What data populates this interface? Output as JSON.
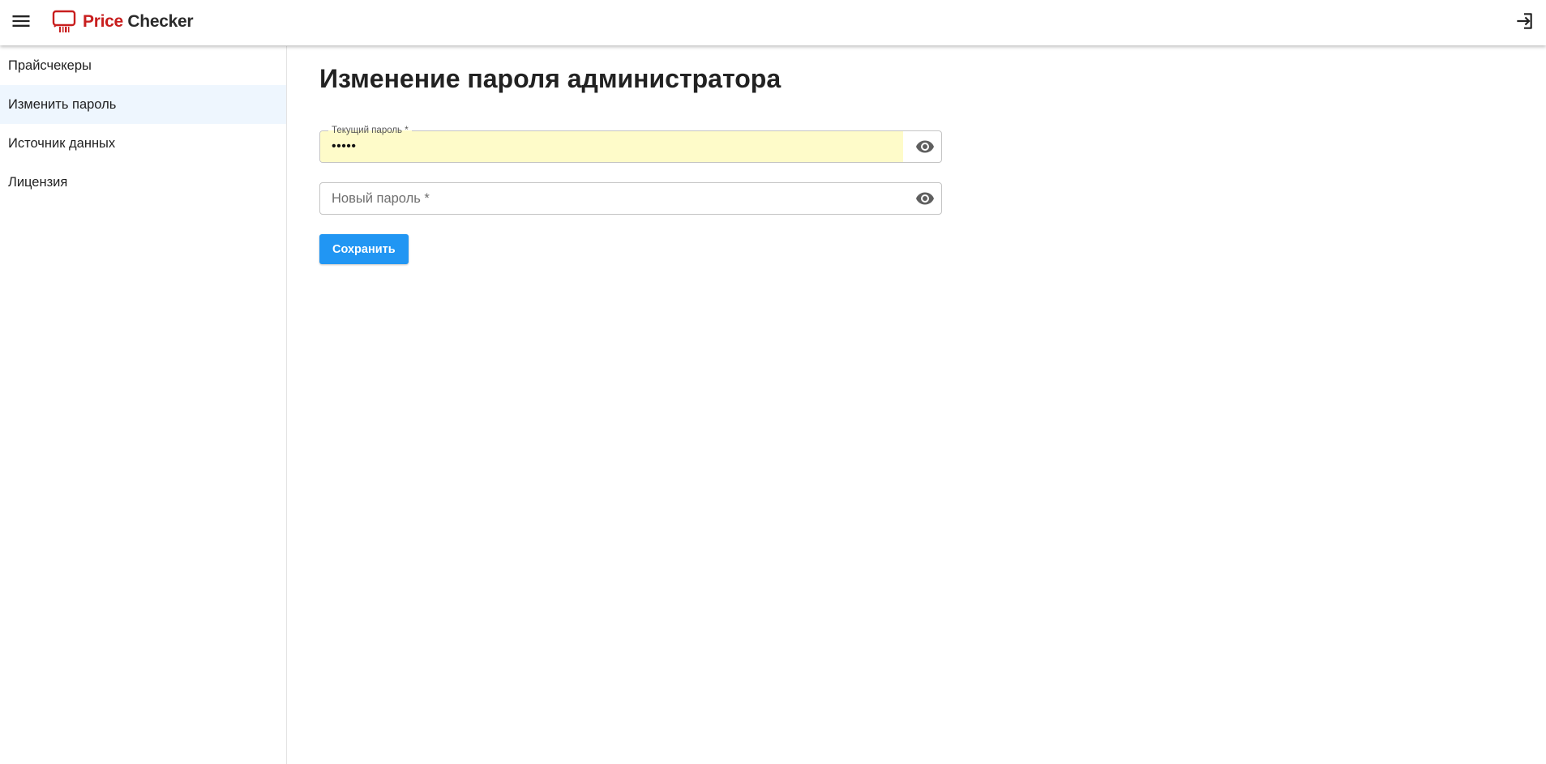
{
  "header": {
    "brand_part1": "Price",
    "brand_part2": "Checker",
    "menu_icon": "hamburger-menu-icon",
    "logout_icon": "logout-icon",
    "brand_color": "#c81e1e"
  },
  "sidebar": {
    "items": [
      {
        "label": "Прайсчекеры",
        "active": false
      },
      {
        "label": "Изменить пароль",
        "active": true
      },
      {
        "label": "Источник данных",
        "active": false
      },
      {
        "label": "Лицензия",
        "active": false
      }
    ]
  },
  "main": {
    "title": "Изменение пароля администратора",
    "current_password": {
      "label": "Текущий пароль *",
      "value": "•••••",
      "icon": "eye-icon"
    },
    "new_password": {
      "placeholder": "Новый пароль *",
      "value": "",
      "icon": "eye-icon"
    },
    "save_label": "Сохранить",
    "accent_color": "#2196f3",
    "autofill_color": "#fefbc9"
  }
}
